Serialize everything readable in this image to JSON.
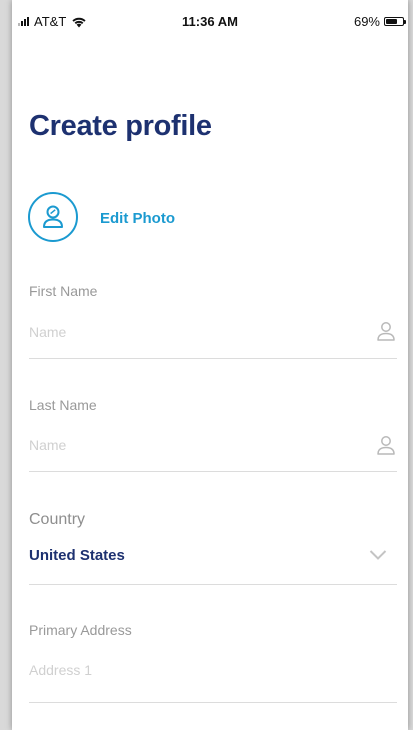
{
  "status_bar": {
    "carrier": "AT&T",
    "time": "11:36 AM",
    "battery": "69%",
    "battery_level": 0.69
  },
  "page_title": "Create profile",
  "photo": {
    "icon": "user-avatar-icon",
    "edit_label": "Edit Photo"
  },
  "fields": {
    "first_name": {
      "label": "First Name",
      "placeholder": "Name",
      "icon": "person-icon"
    },
    "last_name": {
      "label": "Last Name",
      "placeholder": "Name",
      "icon": "person-icon"
    },
    "country": {
      "label": "Country",
      "value": "United States",
      "icon": "chevron-down-icon"
    },
    "primary_address": {
      "label": "Primary Address",
      "placeholder": "Address 1"
    }
  },
  "colors": {
    "title": "#1d3170",
    "accent": "#1b9ad0",
    "label": "#999999",
    "placeholder": "#d0d0d0",
    "divider": "#dcdcdc"
  }
}
